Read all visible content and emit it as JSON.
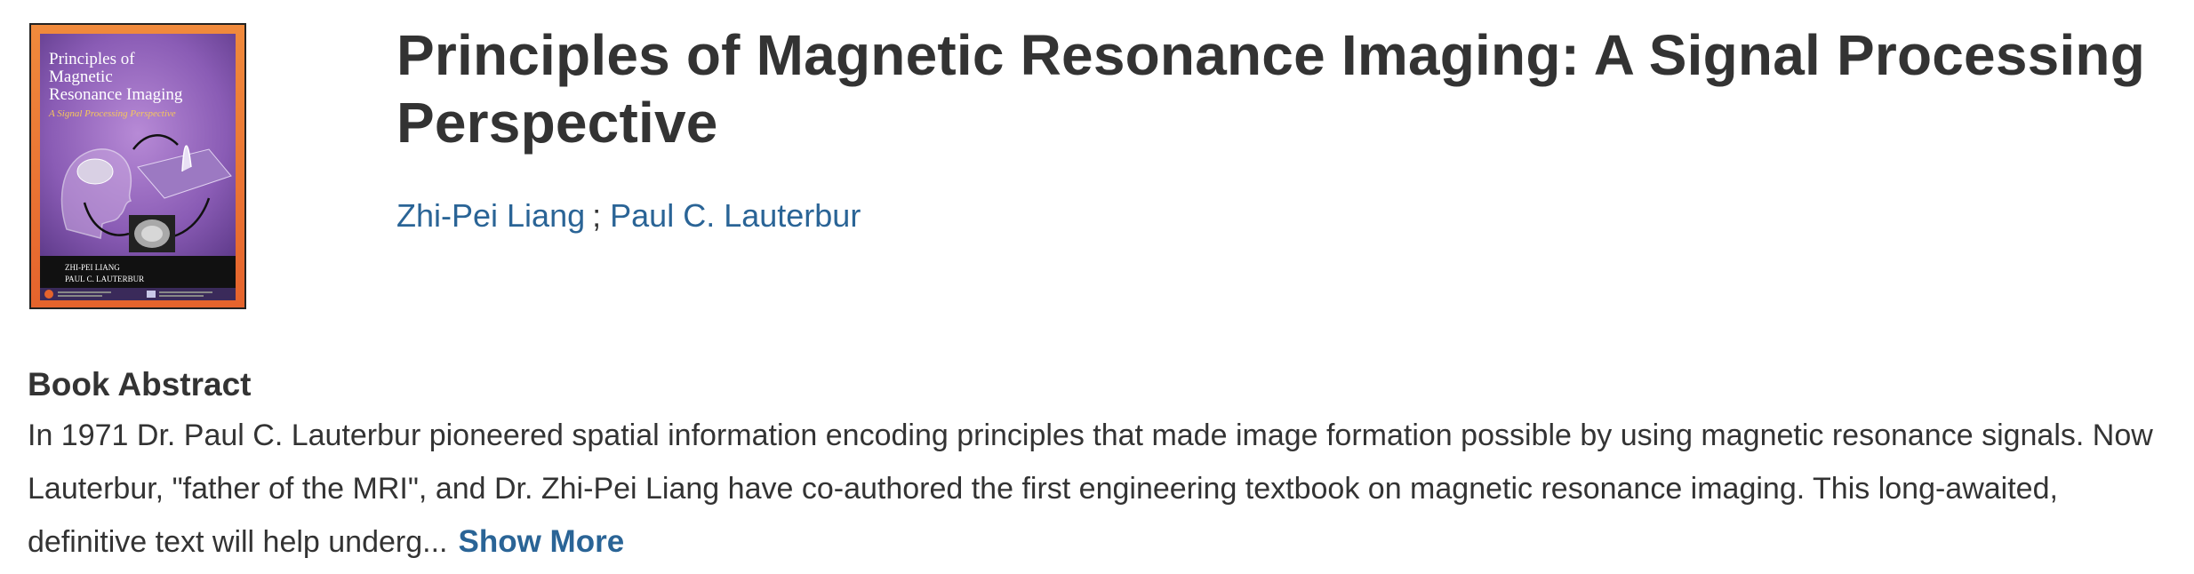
{
  "book": {
    "title": "Principles of Magnetic Resonance Imaging: A Signal Processing Perspective",
    "authors": [
      {
        "name": "Zhi-Pei Liang"
      },
      {
        "name": "Paul C. Lauterbur"
      }
    ],
    "author_separator": ";"
  },
  "cover": {
    "title_line1": "Principles of",
    "title_line2": "Magnetic",
    "title_line3": "Resonance Imaging",
    "subtitle": "A Signal Processing Perspective",
    "author1": "ZHI-PEI LIANG",
    "author2": "PAUL C. LAUTERBUR",
    "colors": {
      "border_orange": "#e8703a",
      "background_purple": "#7b4fa3",
      "bottom_black": "#111111"
    }
  },
  "abstract": {
    "heading": "Book Abstract",
    "text": "In 1971 Dr. Paul C. Lauterbur pioneered spatial information encoding principles that made image formation possible by using magnetic resonance signals. Now Lauterbur, \"father of the MRI\", and Dr. Zhi-Pei Liang have co-authored the first engineering textbook on magnetic resonance imaging. This long-awaited, definitive text will help underg...",
    "show_more_label": "Show More"
  },
  "colors": {
    "link": "#2a6496",
    "text": "#333333"
  }
}
